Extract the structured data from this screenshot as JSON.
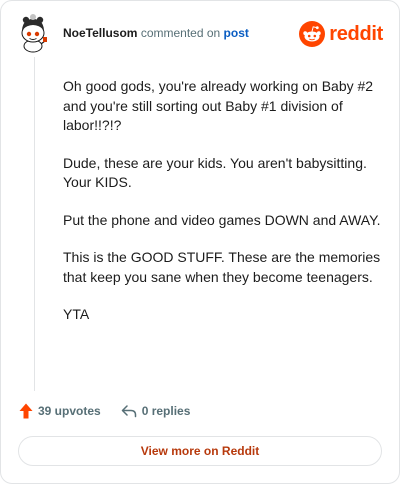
{
  "header": {
    "username": "NoeTellusom",
    "action_text": "commented on",
    "post_link": "post"
  },
  "brand": {
    "name": "reddit",
    "icon": "reddit-snoo-icon",
    "color": "#ff4500"
  },
  "avatar": {
    "icon": "snoo-avatar-icon"
  },
  "comment": {
    "paragraphs": [
      "Oh good gods, you're already working on Baby #2 and you're still sorting out Baby #1 division of labor!!?!?",
      "Dude, these are your kids. You aren't babysitting. Your KIDS.",
      "Put the phone and video games DOWN and AWAY.",
      "This is the GOOD STUFF. These are the memories that keep you sane when they become teenagers.",
      "YTA"
    ]
  },
  "actions": {
    "upvotes_label": "39 upvotes",
    "upvote_icon": "upvote-arrow-icon",
    "upvote_color": "#ff4500",
    "replies_label": "0 replies",
    "reply_icon": "reply-arrow-icon"
  },
  "footer": {
    "view_more_label": "View more on Reddit"
  }
}
